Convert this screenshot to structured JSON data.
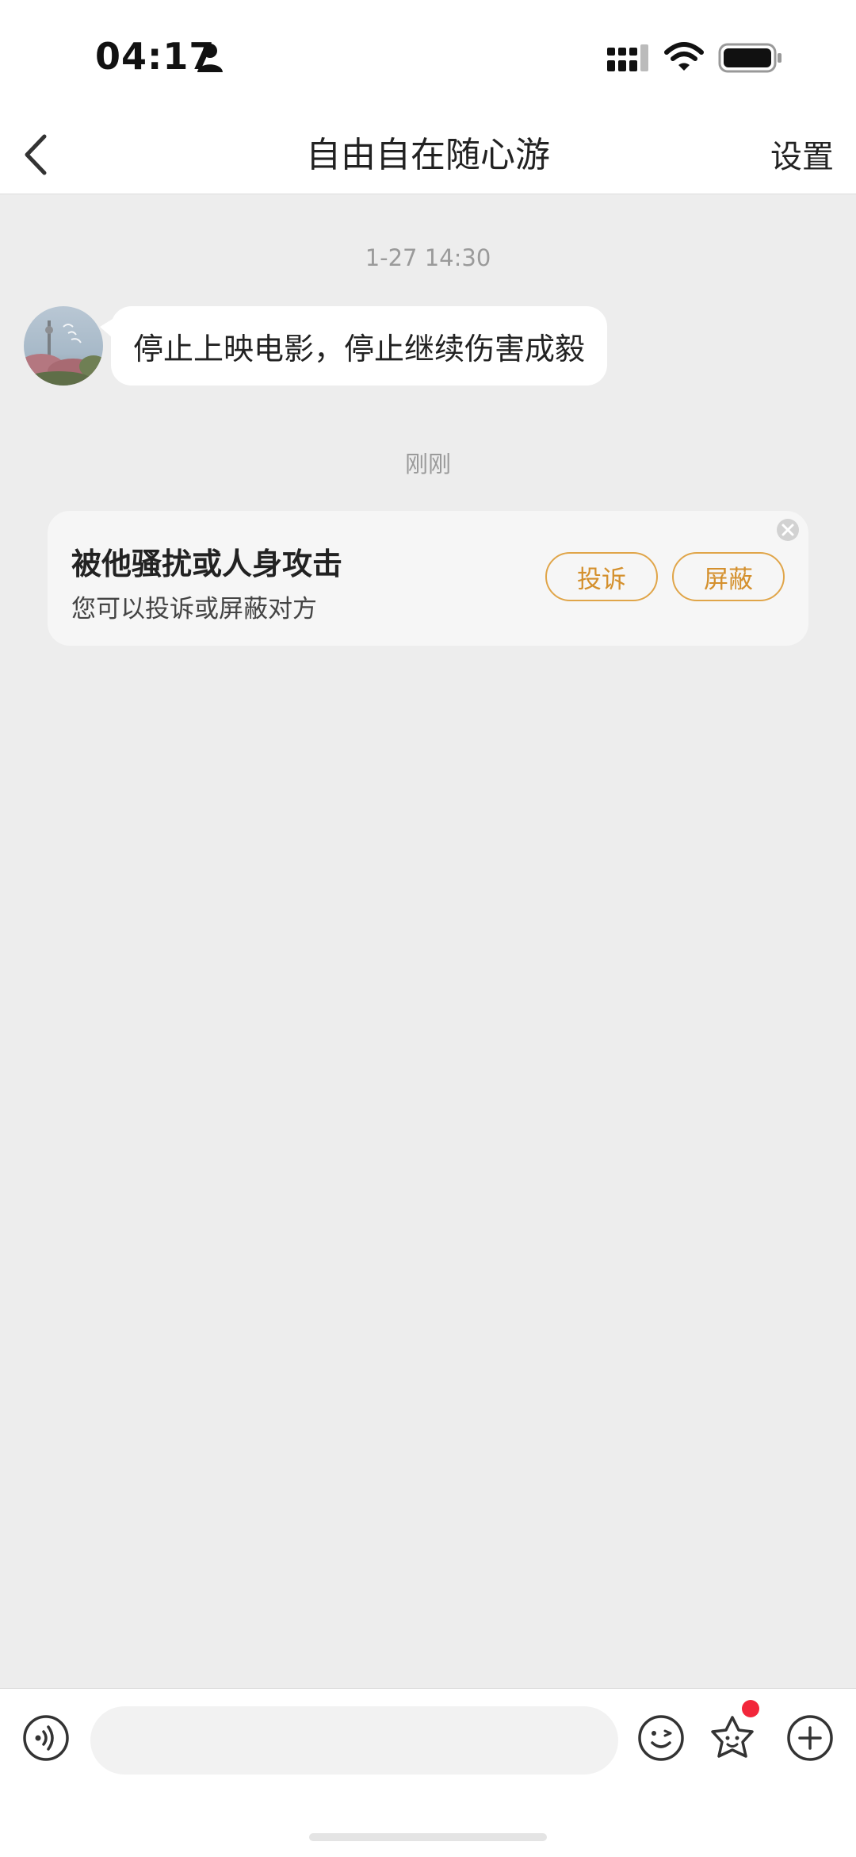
{
  "status_bar": {
    "time": "04:17",
    "icons": [
      "person-icon",
      "signal-icon",
      "wifi-icon",
      "battery-icon"
    ]
  },
  "nav": {
    "back_icon": "chevron-left-icon",
    "title": "自由自在随心游",
    "settings_label": "设置"
  },
  "messages": {
    "timestamp_1": "1-27 14:30",
    "incoming_text": "停止上映电影，停止继续伤害成毅",
    "timestamp_2": "刚刚"
  },
  "harassment_card": {
    "title": "被他骚扰或人身攻击",
    "subtitle": "您可以投诉或屏蔽对方",
    "report_label": "投诉",
    "block_label": "屏蔽",
    "close_icon": "close-circle-icon"
  },
  "input_bar": {
    "placeholder": "",
    "icons": [
      "voice-icon",
      "emoji-icon",
      "sticker-icon",
      "plus-icon"
    ],
    "has_badge": true
  },
  "colors": {
    "accent": "#d4902d",
    "badge": "#f2263a",
    "background": "#ededed"
  }
}
